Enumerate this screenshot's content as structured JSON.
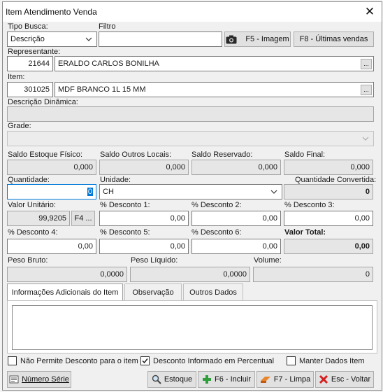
{
  "window": {
    "title": "Item Atendimento Venda",
    "close_glyph": "✕"
  },
  "search": {
    "tipo_busca_label": "Tipo Busca:",
    "tipo_busca_value": "Descrição",
    "filtro_label": "Filtro",
    "filtro_value": "",
    "image_button": "F5 - Imagem",
    "last_sales_button": "F8 - Últimas vendas"
  },
  "representante": {
    "label": "Representante:",
    "code": "21644",
    "name": "ERALDO CARLOS BONILHA"
  },
  "item": {
    "label": "Item:",
    "code": "301025",
    "name": "MDF BRANCO 1L 15 MM"
  },
  "descricao_dinamica": {
    "label": "Descrição Dinâmica:",
    "value": ""
  },
  "grade": {
    "label": "Grade:",
    "value": ""
  },
  "saldos": {
    "estoque_fisico_label": "Saldo Estoque Físico:",
    "estoque_fisico": "0,000",
    "outros_locais_label": "Saldo Outros Locais:",
    "outros_locais": "0,000",
    "reservado_label": "Saldo Reservado:",
    "reservado": "0,000",
    "final_label": "Saldo Final:",
    "final": "0,000"
  },
  "quantidade": {
    "label": "Quantidade:",
    "value": "0"
  },
  "unidade": {
    "label": "Unidade:",
    "value": "CH"
  },
  "quantidade_convertida": {
    "label": "Quantidade Convertida:",
    "value": "0"
  },
  "valor_unitario": {
    "label": "Valor Unitário:",
    "value": "99,9205",
    "button": "F4 ..."
  },
  "descontos": {
    "d1_label": "% Desconto 1:",
    "d1": "0,00",
    "d2_label": "% Desconto 2:",
    "d2": "0,00",
    "d3_label": "% Desconto 3:",
    "d3": "0,00",
    "d4_label": "% Desconto 4:",
    "d4": "0,00",
    "d5_label": "% Desconto 5:",
    "d5": "0,00",
    "d6_label": "% Desconto 6:",
    "d6": "0,00"
  },
  "valor_total": {
    "label": "Valor Total:",
    "value": "0,00"
  },
  "pesos": {
    "bruto_label": "Peso Bruto:",
    "bruto": "0,0000",
    "liquido_label": "Peso Líquido:",
    "liquido": "0,0000",
    "volume_label": "Volume:",
    "volume": "0"
  },
  "tabs": [
    "Informações Adicionais do Item",
    "Observação",
    "Outros Dados"
  ],
  "checkboxes": {
    "nao_permite_desconto": {
      "label": "Não Permite Desconto para o item",
      "checked": false
    },
    "desconto_percentual": {
      "label": "Desconto Informado em Percentual",
      "checked": true
    },
    "manter_dados": {
      "label": "Manter Dados Item",
      "checked": false
    }
  },
  "footer": {
    "numero_serie": "Número Série",
    "estoque": "Estoque",
    "incluir": "F6 - Incluir",
    "limpa": "F7 - Limpa",
    "voltar": "Esc - Voltar"
  },
  "icons": {
    "close": "close-icon",
    "camera": "camera-icon",
    "chevron": "chevron-down-icon",
    "search": "search-icon",
    "plus": "plus-icon",
    "eraser": "eraser-icon",
    "cancel": "cancel-x-icon",
    "serial": "serial-number-icon"
  },
  "colors": {
    "focus": "#0078d7",
    "plus_green": "#2e9e3a",
    "cancel_red": "#d32020",
    "eraser_orange": "#e8862c"
  }
}
